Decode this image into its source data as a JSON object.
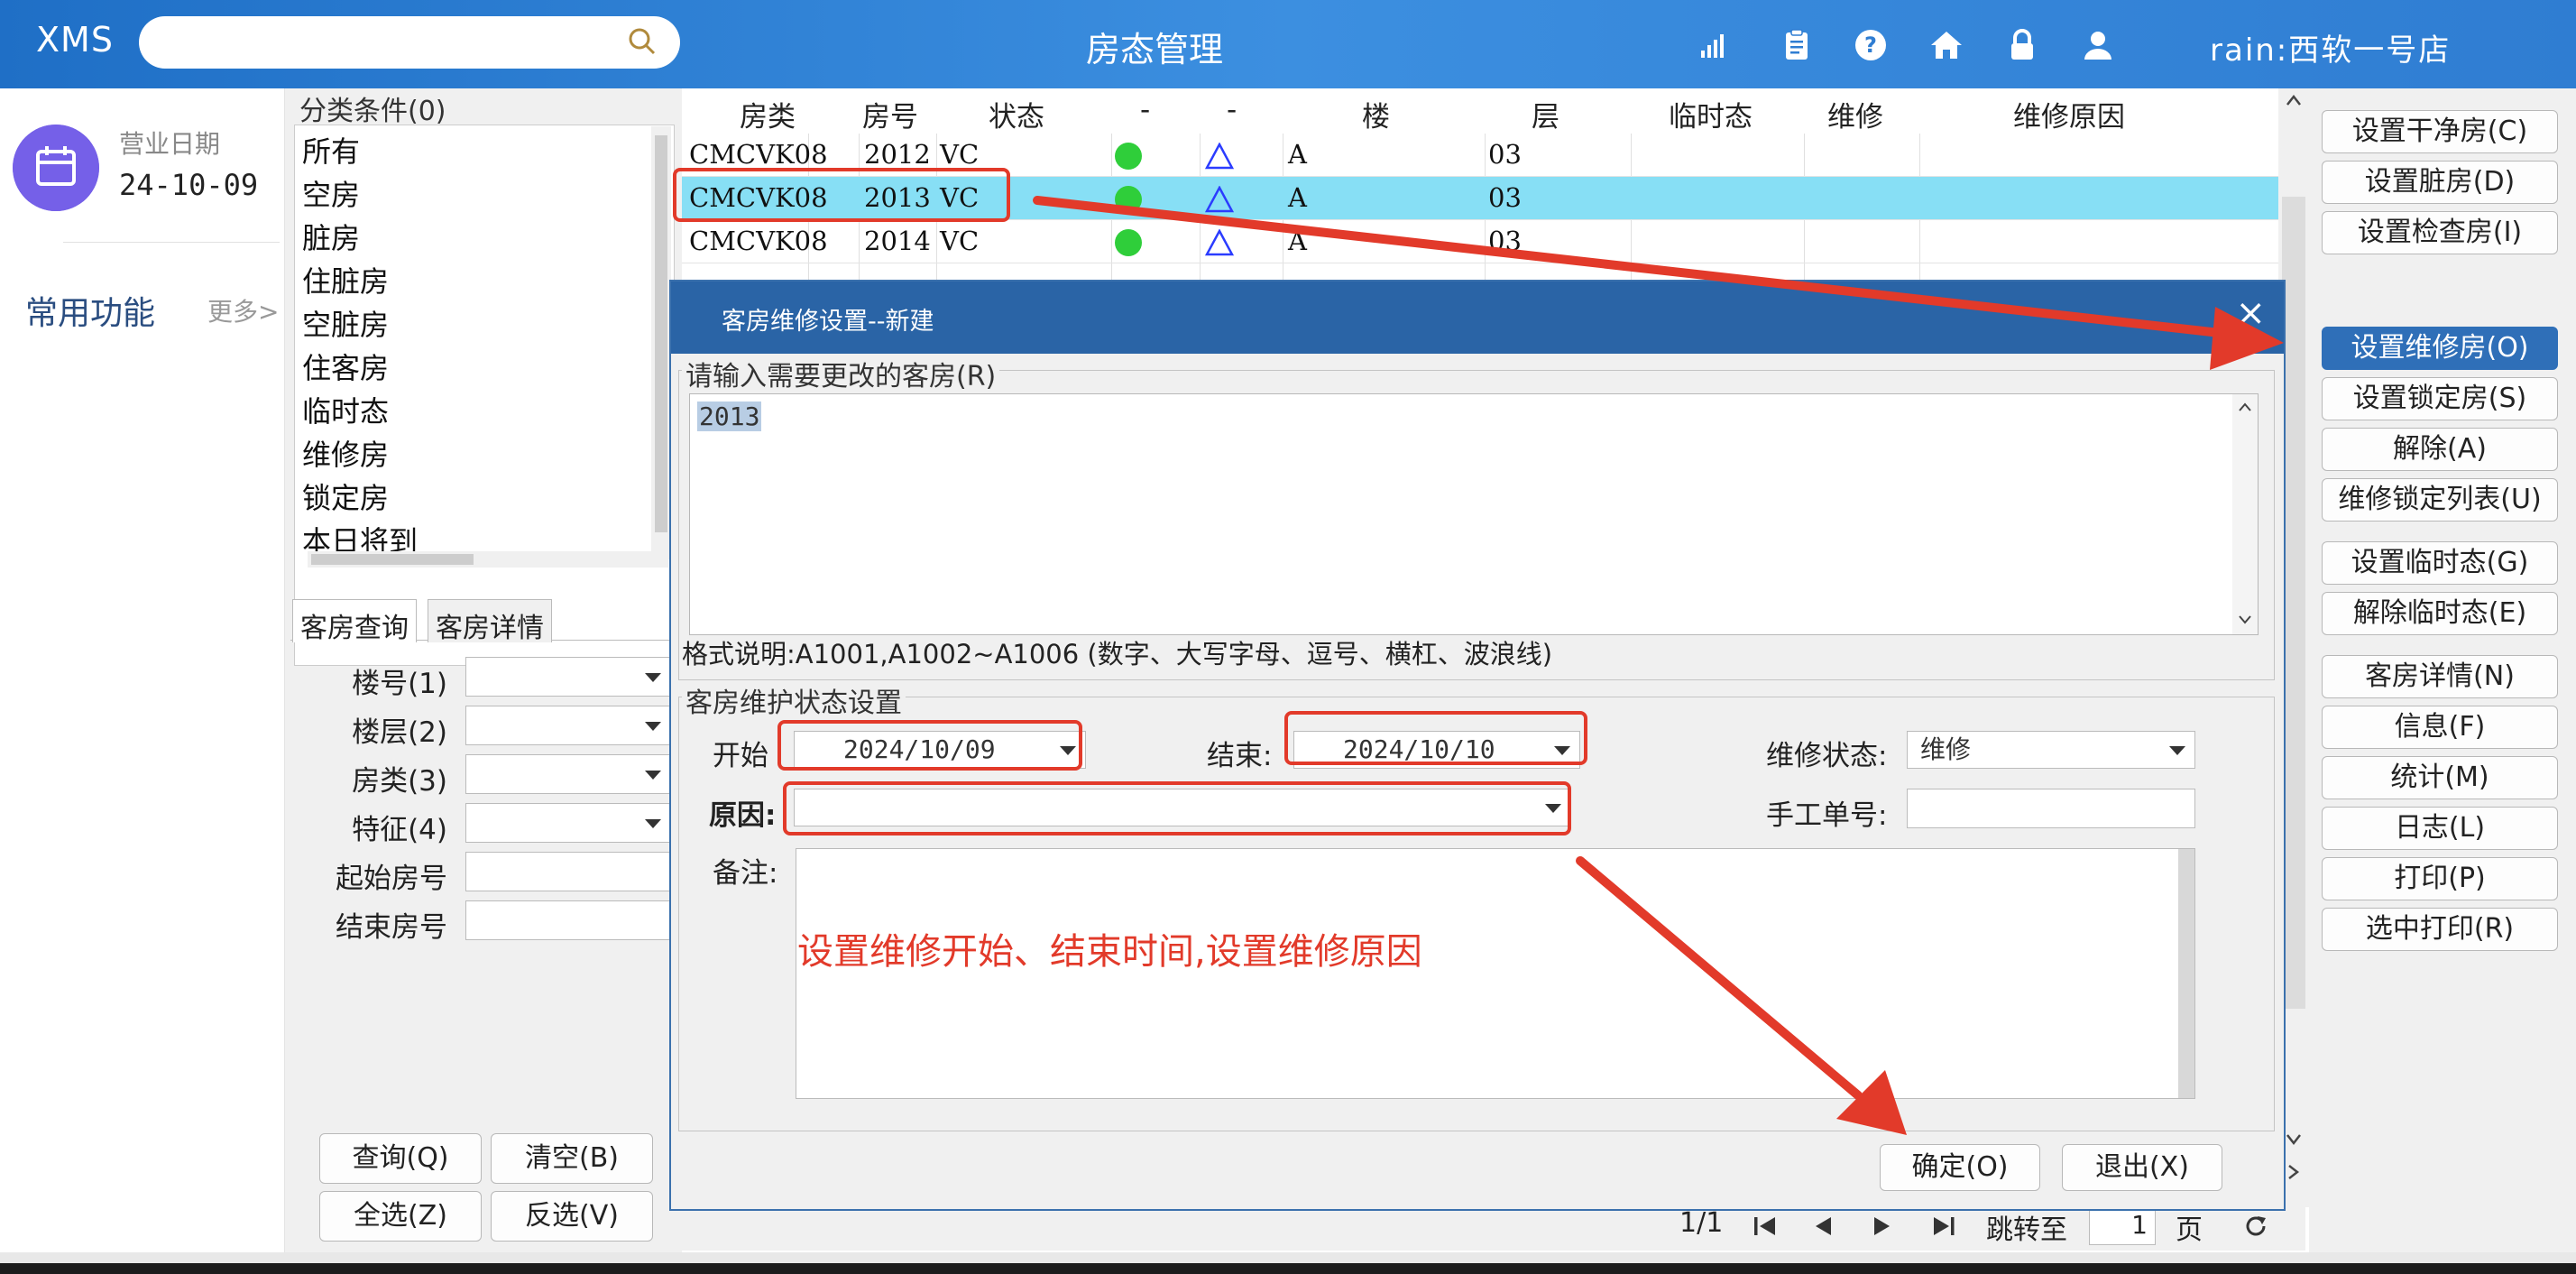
{
  "header": {
    "logo": "XMS",
    "search_placeholder": "",
    "title": "房态管理",
    "icons": [
      "signal-icon",
      "clipboard-icon",
      "help-icon",
      "home-icon",
      "lock-icon",
      "user-icon"
    ],
    "user": "rain:西软一号店"
  },
  "left_nav": {
    "business_date_label": "营业日期",
    "business_date": "24-10-09",
    "common_functions": "常用功能",
    "more": "更多>"
  },
  "category": {
    "title": "分类条件(0)",
    "items": [
      "所有",
      "空房",
      "脏房",
      "住脏房",
      "空脏房",
      "住客房",
      "临时态",
      "维修房",
      "锁定房",
      "本日将到"
    ]
  },
  "query_tabs": [
    "客房查询",
    "客房详情"
  ],
  "query_form": {
    "labels": [
      "楼号(1)",
      "楼层(2)",
      "房类(3)",
      "特征(4)",
      "起始房号",
      "结束房号"
    ],
    "buttons": [
      "查询(Q)",
      "清空(B)",
      "全选(Z)",
      "反选(V)"
    ]
  },
  "table": {
    "headers": [
      "房类",
      "房号",
      "状态",
      "-",
      "-",
      "楼",
      "层",
      "临时态",
      "维修",
      "维修原因"
    ],
    "rows": [
      {
        "type": "CMCVK08",
        "room": "2012",
        "status": "VC",
        "building": "A",
        "floor": "03"
      },
      {
        "type": "CMCVK08",
        "room": "2013",
        "status": "VC",
        "building": "A",
        "floor": "03"
      },
      {
        "type": "CMCVK08",
        "room": "2014",
        "status": "VC",
        "building": "A",
        "floor": "03"
      }
    ]
  },
  "pager": {
    "page": "1/1",
    "jump_label": "跳转至",
    "jump_value": "1",
    "page_unit": "页"
  },
  "actions": {
    "buttons": [
      "设置干净房(C)",
      "设置脏房(D)",
      "设置检查房(I)",
      "设置维修房(O)",
      "设置锁定房(S)",
      "解除(A)",
      "维修锁定列表(U)",
      "设置临时态(G)",
      "解除临时态(E)",
      "客房详情(N)",
      "信息(F)",
      "统计(M)",
      "日志(L)",
      "打印(P)",
      "选中打印(R)"
    ]
  },
  "dialog": {
    "title": "客房维修设置--新建",
    "close": "×",
    "rooms_group": "请输入需要更改的客房(R)",
    "rooms_value": "2013",
    "format_note": "格式说明:A1001,A1002~A1006 (数字、大写字母、逗号、横杠、波浪线)",
    "status_group": "客房维护状态设置",
    "start_label": "开始",
    "start_value": "2024/10/09",
    "end_label": "结束:",
    "end_value": "2024/10/10",
    "maint_status_label": "维修状态:",
    "maint_status_value": "维修",
    "reason_label": "原因:",
    "manual_no_label": "手工单号:",
    "remark_label": "备注:",
    "ok_button": "确定(O)",
    "exit_button": "退出(X)"
  },
  "annotation": {
    "text": "设置维修开始、结束时间,设置维修原因",
    "color": "#e23a2a"
  }
}
